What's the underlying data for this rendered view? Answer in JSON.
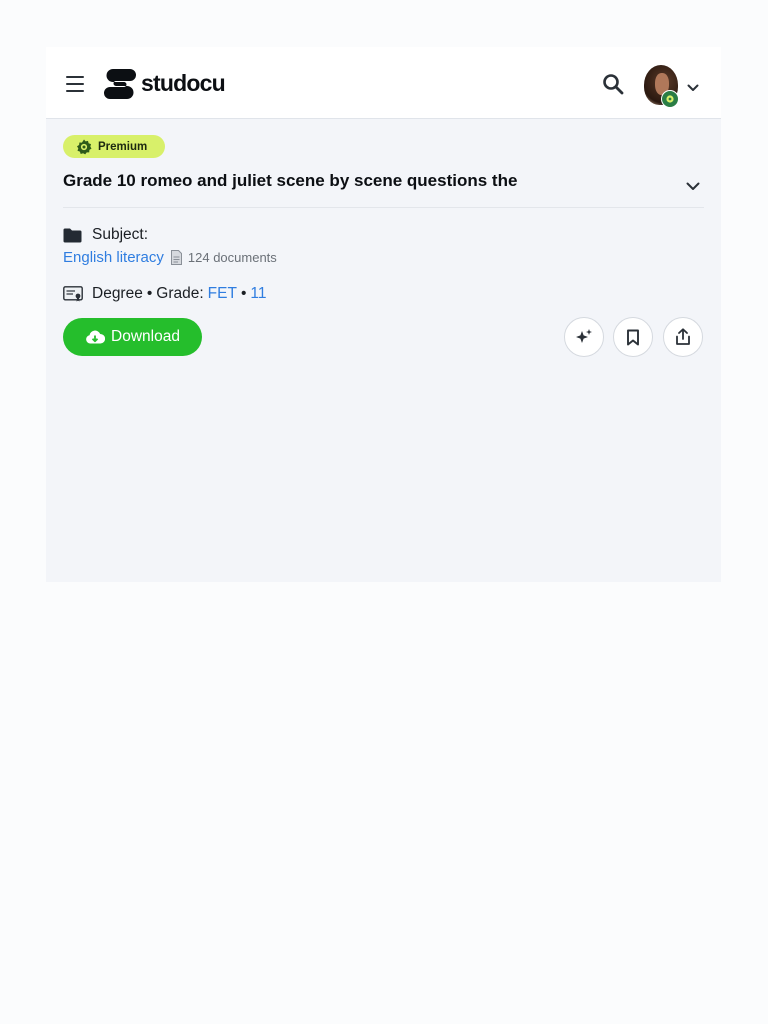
{
  "header": {
    "logo_text": "studocu",
    "icons": {
      "menu": "hamburger-menu-icon",
      "search": "search-icon",
      "user": "user-avatar",
      "chevron": "chevron-down-icon"
    }
  },
  "document": {
    "badge": "Premium",
    "title": "Grade 10 romeo and juliet scene by scene questions the",
    "subject_label": "Subject:",
    "course": "English literacy",
    "course_doc_count": "124 documents",
    "degree": "Degree",
    "grade_label": "Grade:",
    "grade_level": "FET",
    "grade_value": "11"
  },
  "actions": {
    "download_label": "Download",
    "icons": [
      "ai-sparkle-icon",
      "bookmark-icon",
      "share-icon"
    ]
  },
  "colors": {
    "accent_green": "#25be2c",
    "premium_badge": "#d8f06a",
    "link_blue": "#2f7de0"
  }
}
